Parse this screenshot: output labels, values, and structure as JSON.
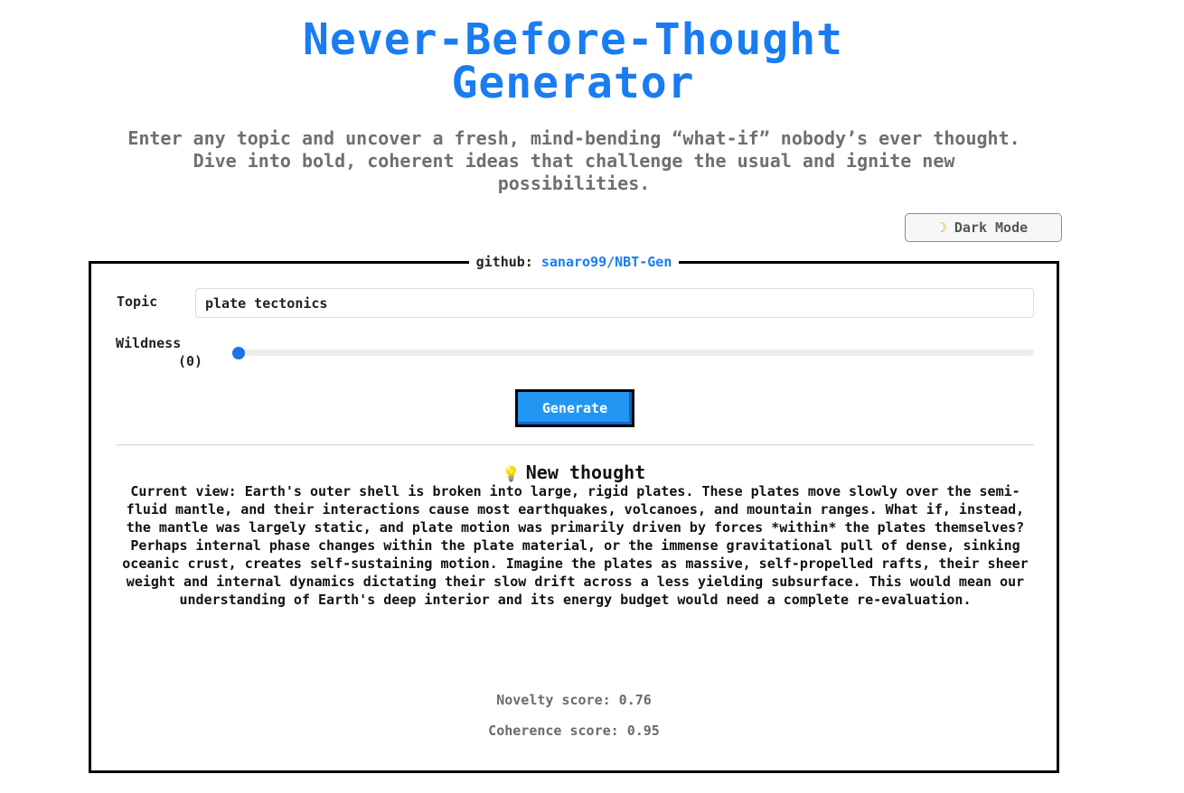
{
  "header": {
    "title_line1": "Never-Before-Thought",
    "title_line2": "Generator",
    "subtitle": "Enter any topic and uncover a fresh, mind-bending “what-if” nobody’s ever thought. Dive into bold, coherent ideas that challenge the usual and ignite new possibilities."
  },
  "dark_mode_button": {
    "icon": "moon-icon",
    "label": "Dark Mode"
  },
  "panel": {
    "legend_prefix": "github:",
    "legend_link": "sanaro99/NBT-Gen",
    "topic_label": "Topic",
    "topic_value": "plate tectonics",
    "wildness_label": "Wildness",
    "wildness_value_text": "(0)",
    "wildness_value": 0,
    "generate_label": "Generate",
    "thought_icon": "lightbulb-icon",
    "thought_heading": "New thought",
    "thought_text": "Current view: Earth's outer shell is broken into large, rigid plates. These plates move slowly over the semi-fluid mantle, and their interactions cause most earthquakes, volcanoes, and mountain ranges. What if, instead, the mantle was largely static, and plate motion was primarily driven by forces *within* the plates themselves? Perhaps internal phase changes within the plate material, or the immense gravitational pull of dense, sinking oceanic crust, creates self-sustaining motion. Imagine the plates as massive, self-propelled rafts, their sheer weight and internal dynamics dictating their slow drift across a less yielding subsurface. This would mean our understanding of Earth's deep interior and its energy budget would need a complete re-evaluation.",
    "novelty_score": "Novelty score: 0.76",
    "coherence_score": "Coherence score: 0.95"
  },
  "colors": {
    "accent": "#1a7cf2",
    "button": "#2196f3"
  }
}
